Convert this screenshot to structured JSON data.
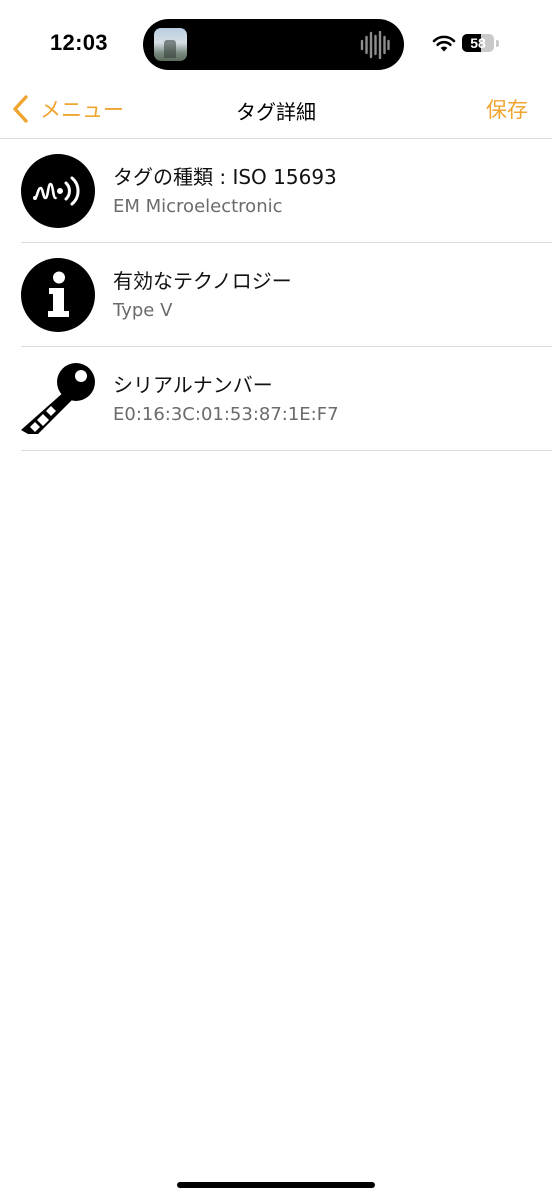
{
  "status_bar": {
    "time": "12:03",
    "battery_level": "58",
    "battery_fraction": 0.58
  },
  "nav": {
    "back_label": "メニュー",
    "title": "タグ詳細",
    "save_label": "保存",
    "accent_color": "#f0a531"
  },
  "rows": [
    {
      "icon": "nfc-signal-icon",
      "title": "タグの種類 : ISO 15693",
      "value": "EM Microelectronic"
    },
    {
      "icon": "info-icon",
      "title": "有効なテクノロジー",
      "value": "Type V"
    },
    {
      "icon": "key-icon",
      "title": "シリアルナンバー",
      "value": "E0:16:3C:01:53:87:1E:F7"
    }
  ]
}
